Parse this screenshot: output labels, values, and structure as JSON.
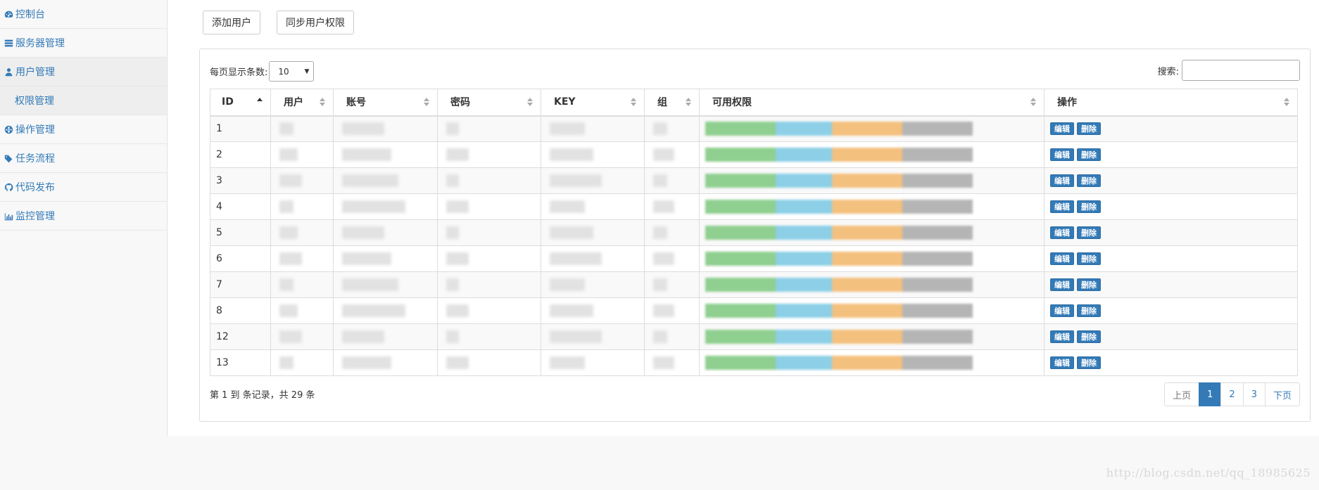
{
  "sidebar": {
    "items": [
      {
        "label": "控制台",
        "icon": "dashboard-icon"
      },
      {
        "label": "服务器管理",
        "icon": "server-icon"
      },
      {
        "label": "用户管理",
        "icon": "user-icon"
      },
      {
        "label": "权限管理",
        "icon": ""
      },
      {
        "label": "操作管理",
        "icon": "globe-icon"
      },
      {
        "label": "任务流程",
        "icon": "tags-icon"
      },
      {
        "label": "代码发布",
        "icon": "github-icon"
      },
      {
        "label": "监控管理",
        "icon": "bar-chart-icon"
      }
    ]
  },
  "toolbar": {
    "add_user": "添加用户",
    "sync_perms": "同步用户权限"
  },
  "table_controls": {
    "length_label": "每页显示条数:",
    "length_value": "10",
    "search_label": "搜索:"
  },
  "table": {
    "columns": [
      "ID",
      "用户",
      "账号",
      "密码",
      "KEY",
      "组",
      "可用权限",
      "操作"
    ],
    "rows": [
      {
        "id": "1"
      },
      {
        "id": "2"
      },
      {
        "id": "3"
      },
      {
        "id": "4"
      },
      {
        "id": "5"
      },
      {
        "id": "6"
      },
      {
        "id": "7"
      },
      {
        "id": "8"
      },
      {
        "id": "12"
      },
      {
        "id": "13"
      }
    ],
    "edit_label": "编辑",
    "delete_label": "删除"
  },
  "pagination": {
    "info": "第 1 到 条记录，共 29 条",
    "prev": "上页",
    "pages": [
      "1",
      "2",
      "3"
    ],
    "next": "下页",
    "current": "1"
  },
  "watermark": "http://blog.csdn.net/qq_18985625",
  "colors": {
    "primary": "#337ab7",
    "perm_green": "#8fcf8f",
    "perm_blue": "#8ccfe6",
    "perm_orange": "#f3c07e",
    "perm_gray": "#b5b5b5"
  }
}
